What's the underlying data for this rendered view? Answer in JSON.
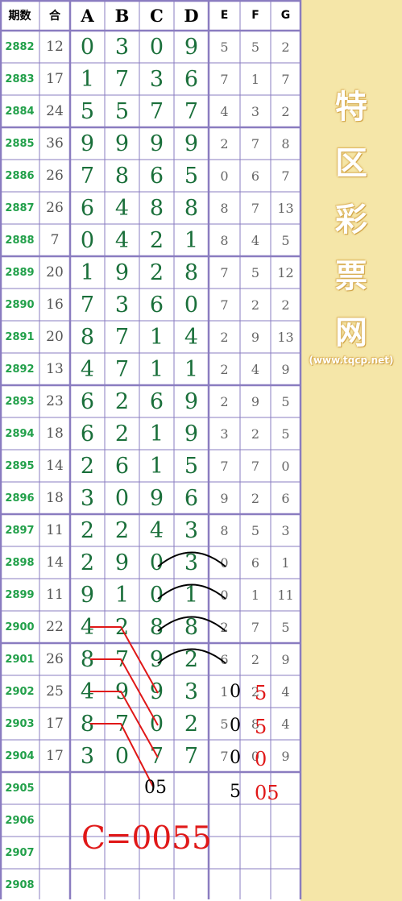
{
  "headers": {
    "period": "期数",
    "sum": "合",
    "a": "A",
    "b": "B",
    "c": "C",
    "d": "D",
    "e": "E",
    "f": "F",
    "g": "G"
  },
  "rows": [
    {
      "period": "2882",
      "sum": "12",
      "abcd": [
        "0",
        "3",
        "0",
        "9"
      ],
      "efg": [
        "5",
        "5",
        "2"
      ]
    },
    {
      "period": "2883",
      "sum": "17",
      "abcd": [
        "1",
        "7",
        "3",
        "6"
      ],
      "efg": [
        "7",
        "1",
        "7"
      ]
    },
    {
      "period": "2884",
      "sum": "24",
      "abcd": [
        "5",
        "5",
        "7",
        "7"
      ],
      "efg": [
        "4",
        "3",
        "2"
      ]
    },
    {
      "period": "2885",
      "sum": "36",
      "abcd": [
        "9",
        "9",
        "9",
        "9"
      ],
      "efg": [
        "2",
        "7",
        "8"
      ]
    },
    {
      "period": "2886",
      "sum": "26",
      "abcd": [
        "7",
        "8",
        "6",
        "5"
      ],
      "efg": [
        "0",
        "6",
        "7"
      ]
    },
    {
      "period": "2887",
      "sum": "26",
      "abcd": [
        "6",
        "4",
        "8",
        "8"
      ],
      "efg": [
        "8",
        "7",
        "13"
      ]
    },
    {
      "period": "2888",
      "sum": "7",
      "abcd": [
        "0",
        "4",
        "2",
        "1"
      ],
      "efg": [
        "8",
        "4",
        "5"
      ]
    },
    {
      "period": "2889",
      "sum": "20",
      "abcd": [
        "1",
        "9",
        "2",
        "8"
      ],
      "efg": [
        "7",
        "5",
        "12"
      ]
    },
    {
      "period": "2890",
      "sum": "16",
      "abcd": [
        "7",
        "3",
        "6",
        "0"
      ],
      "efg": [
        "7",
        "2",
        "2"
      ]
    },
    {
      "period": "2891",
      "sum": "20",
      "abcd": [
        "8",
        "7",
        "1",
        "4"
      ],
      "efg": [
        "2",
        "9",
        "13"
      ]
    },
    {
      "period": "2892",
      "sum": "13",
      "abcd": [
        "4",
        "7",
        "1",
        "1"
      ],
      "efg": [
        "2",
        "4",
        "9"
      ]
    },
    {
      "period": "2893",
      "sum": "23",
      "abcd": [
        "6",
        "2",
        "6",
        "9"
      ],
      "efg": [
        "2",
        "9",
        "5"
      ]
    },
    {
      "period": "2894",
      "sum": "18",
      "abcd": [
        "6",
        "2",
        "1",
        "9"
      ],
      "efg": [
        "3",
        "2",
        "5"
      ]
    },
    {
      "period": "2895",
      "sum": "14",
      "abcd": [
        "2",
        "6",
        "1",
        "5"
      ],
      "efg": [
        "7",
        "7",
        "0"
      ]
    },
    {
      "period": "2896",
      "sum": "18",
      "abcd": [
        "3",
        "0",
        "9",
        "6"
      ],
      "efg": [
        "9",
        "2",
        "6"
      ]
    },
    {
      "period": "2897",
      "sum": "11",
      "abcd": [
        "2",
        "2",
        "4",
        "3"
      ],
      "efg": [
        "8",
        "5",
        "3"
      ]
    },
    {
      "period": "2898",
      "sum": "14",
      "abcd": [
        "2",
        "9",
        "0",
        "3"
      ],
      "efg": [
        "0",
        "6",
        "1"
      ]
    },
    {
      "period": "2899",
      "sum": "11",
      "abcd": [
        "9",
        "1",
        "0",
        "1"
      ],
      "efg": [
        "0",
        "1",
        "11"
      ]
    },
    {
      "period": "2900",
      "sum": "22",
      "abcd": [
        "4",
        "2",
        "8",
        "8"
      ],
      "efg": [
        "2",
        "7",
        "5"
      ]
    },
    {
      "period": "2901",
      "sum": "26",
      "abcd": [
        "8",
        "7",
        "9",
        "2"
      ],
      "efg": [
        "6",
        "2",
        "9"
      ]
    },
    {
      "period": "2902",
      "sum": "25",
      "abcd": [
        "4",
        "9",
        "9",
        "3"
      ],
      "efg": [
        "1",
        "2",
        "4"
      ]
    },
    {
      "period": "2903",
      "sum": "17",
      "abcd": [
        "8",
        "7",
        "0",
        "2"
      ],
      "efg": [
        "5",
        "8",
        "4"
      ]
    },
    {
      "period": "2904",
      "sum": "17",
      "abcd": [
        "3",
        "0",
        "7",
        "7"
      ],
      "efg": [
        "7",
        "0",
        "9"
      ]
    },
    {
      "period": "2905",
      "sum": "",
      "abcd": [
        "",
        "",
        "",
        ""
      ],
      "efg": [
        "",
        "",
        ""
      ]
    },
    {
      "period": "2906",
      "sum": "",
      "abcd": [
        "",
        "",
        "",
        ""
      ],
      "efg": [
        "",
        "",
        ""
      ]
    },
    {
      "period": "2907",
      "sum": "",
      "abcd": [
        "",
        "",
        "",
        ""
      ],
      "efg": [
        "",
        "",
        ""
      ]
    },
    {
      "period": "2908",
      "sum": "",
      "abcd": [
        "",
        "",
        "",
        ""
      ],
      "efg": [
        "",
        "",
        ""
      ]
    }
  ],
  "annotations": {
    "prediction_c": "05",
    "black_col": [
      "0",
      "0",
      "0",
      "5"
    ],
    "red_col": [
      "5",
      "5",
      "0",
      "05"
    ],
    "formula": "C=0055"
  },
  "watermark": {
    "chars": [
      "特",
      "区",
      "彩",
      "票",
      "网"
    ],
    "url": "(www.tqcp.net)"
  },
  "colors": {
    "grid": "#8a7cc0",
    "side": "#f5e6a8",
    "period": "#22a04a",
    "digit": "#1a6f3a",
    "annotation_red": "#e01818"
  }
}
